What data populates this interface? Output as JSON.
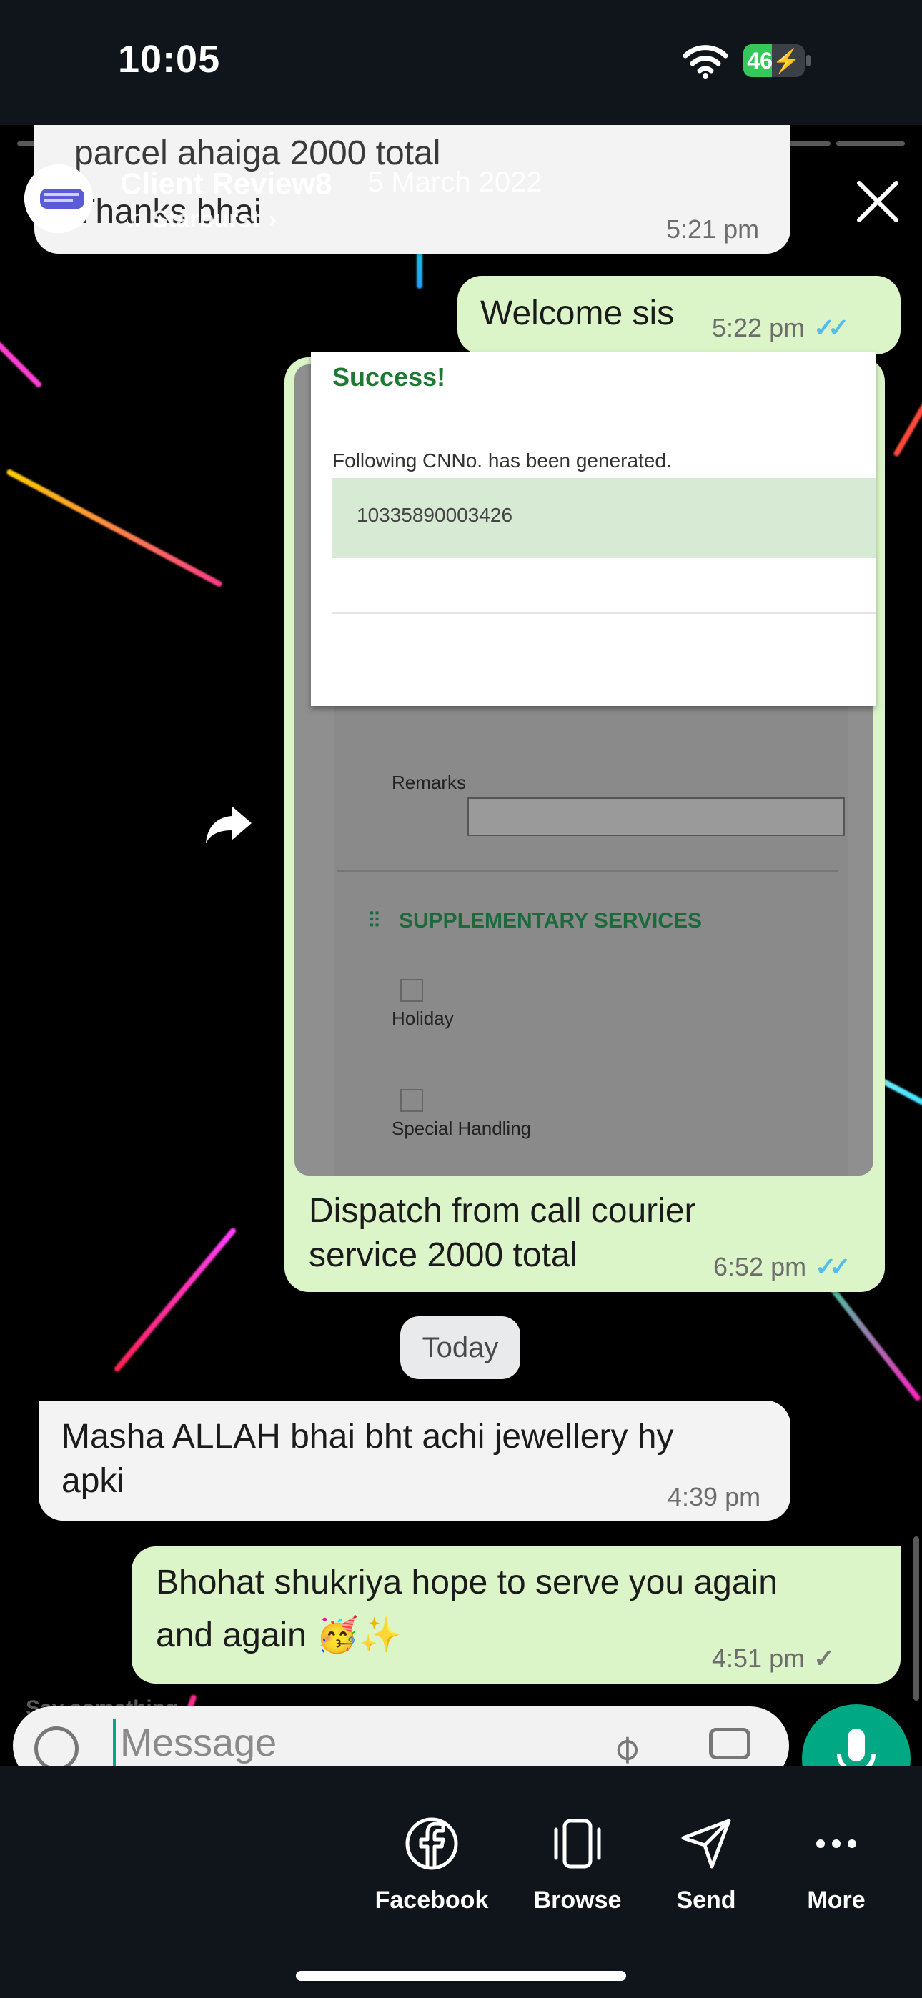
{
  "status_bar": {
    "time": "10:05",
    "battery_level": "46",
    "battery_percent": 46
  },
  "story": {
    "username": "Client Review8",
    "date": "5 March 2022",
    "music_label": "Starburst",
    "progress": {
      "total_segments": 12,
      "completed_segments": 0
    }
  },
  "chat": {
    "messages": [
      {
        "direction": "in",
        "text_line1": "parcel ahaiga 2000 total",
        "text_line2": "Thanks bhai",
        "time": "5:21 pm"
      },
      {
        "direction": "out",
        "text": "Welcome sis",
        "time": "5:22 pm",
        "ticks": "✓✓"
      },
      {
        "direction": "out",
        "type": "image",
        "caption_line1": "Dispatch from call courier",
        "caption_line2": "service 2000 total",
        "time": "6:52 pm",
        "ticks": "✓✓"
      },
      {
        "direction": "in",
        "text_line1": "Masha ALLAH bhai bht achi jewellery hy",
        "text_line2": "apki",
        "time": "4:39 pm"
      },
      {
        "direction": "out",
        "text_line1": "Bhohat shukriya hope to serve you again",
        "text_line2": "and again 🥳✨",
        "time": "4:51 pm",
        "ticks": "✓"
      }
    ],
    "date_divider": "Today",
    "composer": {
      "placeholder": "Message",
      "say_something": "Say something..."
    }
  },
  "embedded_screenshot": {
    "success_title": "Success!",
    "cn_label": "Following CNNo. has been generated.",
    "cn_number": "10335890003426",
    "remarks_label": "Remarks",
    "supplementary_title": "SUPPLEMENTARY SERVICES",
    "holiday_label": "Holiday",
    "special_handling_label": "Special Handling"
  },
  "actions": [
    {
      "label": "Facebook",
      "icon": "facebook-icon"
    },
    {
      "label": "Browse",
      "icon": "browse-icon"
    },
    {
      "label": "Send",
      "icon": "send-icon"
    },
    {
      "label": "More",
      "icon": "more-icon"
    }
  ],
  "colors": {
    "accent_green": "#00a884",
    "outgoing_bubble": "#dbf5c8",
    "incoming_bubble": "#f3f3f3",
    "read_ticks": "#53bdeb",
    "background": "#10141b"
  }
}
